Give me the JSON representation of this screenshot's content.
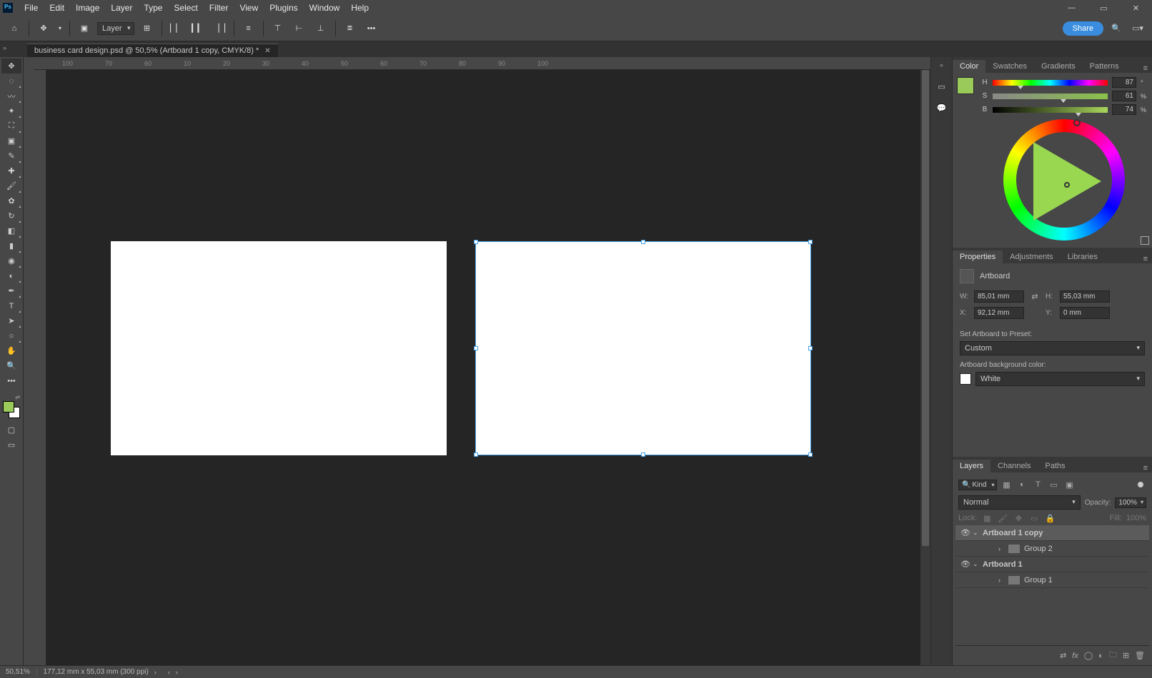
{
  "menus": [
    "File",
    "Edit",
    "Image",
    "Layer",
    "Type",
    "Select",
    "Filter",
    "View",
    "Plugins",
    "Window",
    "Help"
  ],
  "options": {
    "layer_dd": "Layer",
    "share": "Share"
  },
  "doc_tab": "business card design.psd @ 50,5% (Artboard 1 copy, CMYK/8) *",
  "ruler_ticks": [
    "100",
    "70",
    "60",
    "10",
    "20",
    "30",
    "40",
    "50",
    "60",
    "70",
    "80",
    "90",
    "100"
  ],
  "color_panel": {
    "tabs": [
      "Color",
      "Swatches",
      "Gradients",
      "Patterns"
    ],
    "h_label": "H",
    "s_label": "S",
    "b_label": "B",
    "h_val": "87",
    "s_val": "61",
    "b_val": "74",
    "deg": "°",
    "pct": "%"
  },
  "props_panel": {
    "tabs": [
      "Properties",
      "Adjustments",
      "Libraries"
    ],
    "title": "Artboard",
    "w_label": "W:",
    "h_label": "H:",
    "x_label": "X:",
    "y_label": "Y:",
    "w": "85,01 mm",
    "h": "55,03 mm",
    "x": "92,12 mm",
    "y": "0 mm",
    "preset_label": "Set Artboard to Preset:",
    "preset_value": "Custom",
    "bgcolor_label": "Artboard background color:",
    "bgcolor_value": "White"
  },
  "layers_panel": {
    "tabs": [
      "Layers",
      "Channels",
      "Paths"
    ],
    "kind": "Kind",
    "blend": "Normal",
    "opacity_label": "Opacity:",
    "opacity_value": "100%",
    "lock_label": "Lock:",
    "fill_label": "Fill:",
    "fill_value": "100%",
    "items": [
      {
        "type": "artboard",
        "name": "Artboard 1 copy",
        "active": true,
        "eye": true
      },
      {
        "type": "group",
        "name": "Group 2",
        "indent": 2,
        "eye": false
      },
      {
        "type": "artboard",
        "name": "Artboard 1",
        "active": false,
        "eye": true
      },
      {
        "type": "group",
        "name": "Group 1",
        "indent": 2,
        "eye": false
      }
    ]
  },
  "status": {
    "zoom": "50,51%",
    "dims": "177,12 mm x 55,03 mm (300 ppi)"
  }
}
